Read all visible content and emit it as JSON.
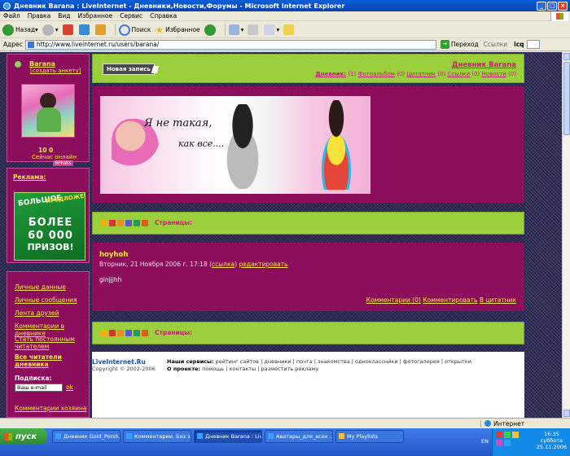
{
  "window": {
    "title": "Дневник Barana : LiveInternet - Дневники,Новости,Форумы - Microsoft Internet Explorer"
  },
  "menu": [
    "Файл",
    "Правка",
    "Вид",
    "Избранное",
    "Сервис",
    "Справка"
  ],
  "toolbar": {
    "back": "Назад",
    "search": "Поиск",
    "favorites": "Избранное"
  },
  "address": {
    "label": "Адрес",
    "url": "http://www.liveinternet.ru/users/barana/",
    "go": "Переход",
    "links": "Ссылки",
    "icq": "icq"
  },
  "profile": {
    "name": "Barana",
    "create_profile": "[создать анкету]",
    "avatar_caption": "ЯРКИХ",
    "rating": "10 0",
    "online_status": "Сейчас онлайн"
  },
  "ad": {
    "title": "Реклама:",
    "line1": "БОЛЬШОЕ",
    "line2": "ПРЕДЛОЖЕНИЕ",
    "line3": "БОЛЕЕ",
    "line4": "60 000",
    "line5": "ПРИЗОВ!"
  },
  "sidebar_links": [
    "Личные данные",
    "Личные сообщения",
    "Лента друзей",
    "Комментарии в дневнике",
    "Стать постоянным читателем",
    "Все читатели дневника"
  ],
  "subscribe": {
    "label": "Подписка:",
    "placeholder": "Ваш e-mail",
    "ok": "ok",
    "owner_comments": "Комментарии хозяина"
  },
  "header": {
    "new_post": "Новая запись",
    "diary_title": "Дневник Barana",
    "nav_prefix": "Дневник:",
    "nav_items": [
      "(1)",
      "Фотоальбом",
      "(0)",
      "Цитатник",
      "(0)",
      "Ссылки",
      "(0)",
      "Новости",
      "(0)"
    ]
  },
  "banner": {
    "text1": "Я не такая,",
    "text2": "как все...."
  },
  "strip": {
    "label": "Страницы:"
  },
  "post": {
    "title": "hoyhoh",
    "date": "Вторник, 21 Ноября 2006 г. 17:18",
    "link": "ссылка",
    "edit": "редактировать",
    "body": "ginjjjhh",
    "comments": "Комментарии (0)",
    "comment_action": "Комментировать",
    "quote": "В цитатник"
  },
  "footer": {
    "logo": "LiveInternet.Ru",
    "copyright": "Copyright © 2002-2006",
    "services_label": "Наши сервисы:",
    "services": "рейтинг сайтов | дневники | почта | знакомства | одноклассники | фотогалерея | открытки",
    "project_label": "О проекте:",
    "project": "помощь | контакты | разместить рекламу"
  },
  "status": {
    "zone": "Интернет"
  },
  "taskbar": {
    "start": "пуск",
    "tasks": [
      "Дневник Gold_Porsh...",
      "Комментарии. Без з...",
      "Дневник Barana : Liv...",
      "Аватары_для_всех ...",
      "My Playlists"
    ],
    "lang": "EN",
    "time": "16:35",
    "weekday": "суббота",
    "date": "25.11.2006"
  },
  "colors": {
    "magenta": "#8b0d5c",
    "lime": "#9bcf3c",
    "link_yellow": "#f5e642",
    "title_pink": "#d9167e"
  }
}
